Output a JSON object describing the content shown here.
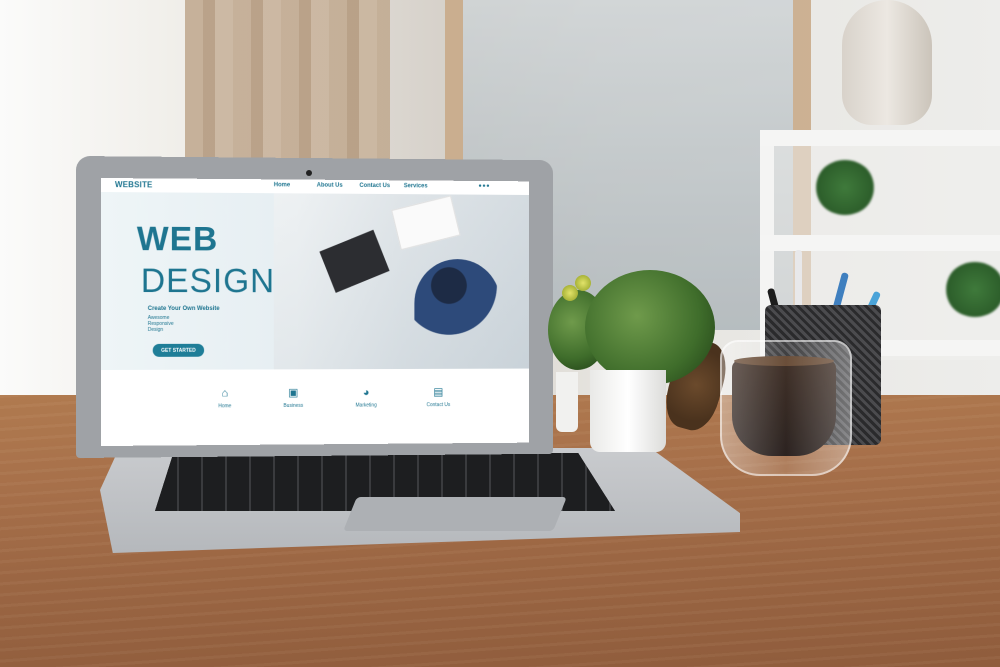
{
  "website": {
    "logo": "WEBSITE",
    "nav": [
      "Home",
      "About Us",
      "Contact Us",
      "Services"
    ],
    "menu_icon": "more-dots-icon",
    "hero": {
      "title_line1": "WEB",
      "title_line2": "DESIGN",
      "subtitle": "Create Your Own Website",
      "tags": [
        "Awesome",
        "Responsive",
        "Design"
      ],
      "cta_label": "GET STARTED"
    },
    "services": [
      {
        "icon": "home-icon",
        "label": "Home"
      },
      {
        "icon": "briefcase-icon",
        "label": "Business"
      },
      {
        "icon": "pie-chart-icon",
        "label": "Marketing"
      },
      {
        "icon": "chat-icon",
        "label": "Contact Us"
      }
    ],
    "accent_color": "#1e7590"
  }
}
